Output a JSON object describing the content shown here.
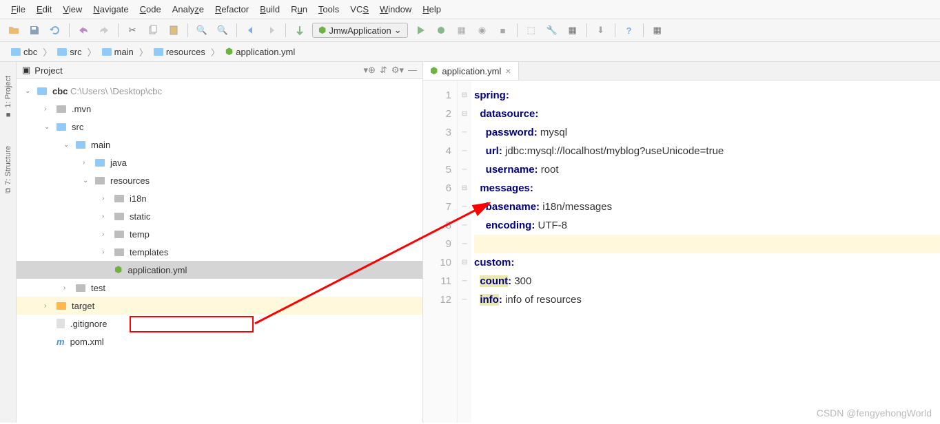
{
  "menu": [
    "File",
    "Edit",
    "View",
    "Navigate",
    "Code",
    "Analyze",
    "Refactor",
    "Build",
    "Run",
    "Tools",
    "VCS",
    "Window",
    "Help"
  ],
  "run_config": "JmwApplication",
  "breadcrumbs": [
    {
      "icon": "folder",
      "label": "cbc"
    },
    {
      "icon": "folder",
      "label": "src"
    },
    {
      "icon": "folder",
      "label": "main"
    },
    {
      "icon": "folder",
      "label": "resources"
    },
    {
      "icon": "spring",
      "label": "application.yml"
    }
  ],
  "panel": {
    "title": "Project"
  },
  "tool_tabs": {
    "project": "1: Project",
    "structure": "7: Structure"
  },
  "tree": [
    {
      "depth": 0,
      "arrow": "v",
      "icon": "folder-blue",
      "label": "cbc",
      "suffix": "C:\\Users\\          \\Desktop\\cbc",
      "bold": true
    },
    {
      "depth": 1,
      "arrow": ">",
      "icon": "folder-grey",
      "label": ".mvn"
    },
    {
      "depth": 1,
      "arrow": "v",
      "icon": "folder-blue",
      "label": "src"
    },
    {
      "depth": 2,
      "arrow": "v",
      "icon": "folder-blue",
      "label": "main"
    },
    {
      "depth": 3,
      "arrow": ">",
      "icon": "folder-blue",
      "label": "java"
    },
    {
      "depth": 3,
      "arrow": "v",
      "icon": "folder-grey",
      "label": "resources"
    },
    {
      "depth": 4,
      "arrow": ">",
      "icon": "folder-grey",
      "label": "i18n"
    },
    {
      "depth": 4,
      "arrow": ">",
      "icon": "folder-grey",
      "label": "static"
    },
    {
      "depth": 4,
      "arrow": ">",
      "icon": "folder-grey",
      "label": "temp"
    },
    {
      "depth": 4,
      "arrow": ">",
      "icon": "folder-grey",
      "label": "templates"
    },
    {
      "depth": 4,
      "arrow": "",
      "icon": "spring",
      "label": "application.yml",
      "selected": true
    },
    {
      "depth": 2,
      "arrow": ">",
      "icon": "folder-grey",
      "label": "test"
    },
    {
      "depth": 1,
      "arrow": ">",
      "icon": "folder-orange",
      "label": "target",
      "hl": true
    },
    {
      "depth": 1,
      "arrow": "",
      "icon": "file",
      "label": ".gitignore"
    },
    {
      "depth": 1,
      "arrow": "",
      "icon": "maven",
      "label": "pom.xml"
    }
  ],
  "tab": {
    "label": "application.yml"
  },
  "code": {
    "lines": [
      {
        "n": 1,
        "indent": 0,
        "key": "spring",
        "sep": ":",
        "val": ""
      },
      {
        "n": 2,
        "indent": 1,
        "key": "datasource",
        "sep": ":",
        "val": ""
      },
      {
        "n": 3,
        "indent": 2,
        "key": "password",
        "sep": ":",
        "val": " mysql"
      },
      {
        "n": 4,
        "indent": 2,
        "key": "url",
        "sep": ":",
        "val": " jdbc:mysql://localhost/myblog?useUnicode=true"
      },
      {
        "n": 5,
        "indent": 2,
        "key": "username",
        "sep": ":",
        "val": " root"
      },
      {
        "n": 6,
        "indent": 1,
        "key": "messages",
        "sep": ":",
        "val": ""
      },
      {
        "n": 7,
        "indent": 2,
        "key": "basename",
        "sep": ":",
        "val": " i18n/messages"
      },
      {
        "n": 8,
        "indent": 2,
        "key": "encoding",
        "sep": ":",
        "val": " UTF-8"
      },
      {
        "n": 9,
        "indent": 0,
        "key": "",
        "sep": "",
        "val": "",
        "hl": true
      },
      {
        "n": 10,
        "indent": 0,
        "key": "custom",
        "sep": ":",
        "val": ""
      },
      {
        "n": 11,
        "indent": 1,
        "key": "count",
        "sep": ":",
        "val": " 300",
        "hlkey": true
      },
      {
        "n": 12,
        "indent": 1,
        "key": "info",
        "sep": ":",
        "val": " info of resources",
        "hlkey": true
      }
    ]
  },
  "watermark": "CSDN @fengyehongWorld"
}
